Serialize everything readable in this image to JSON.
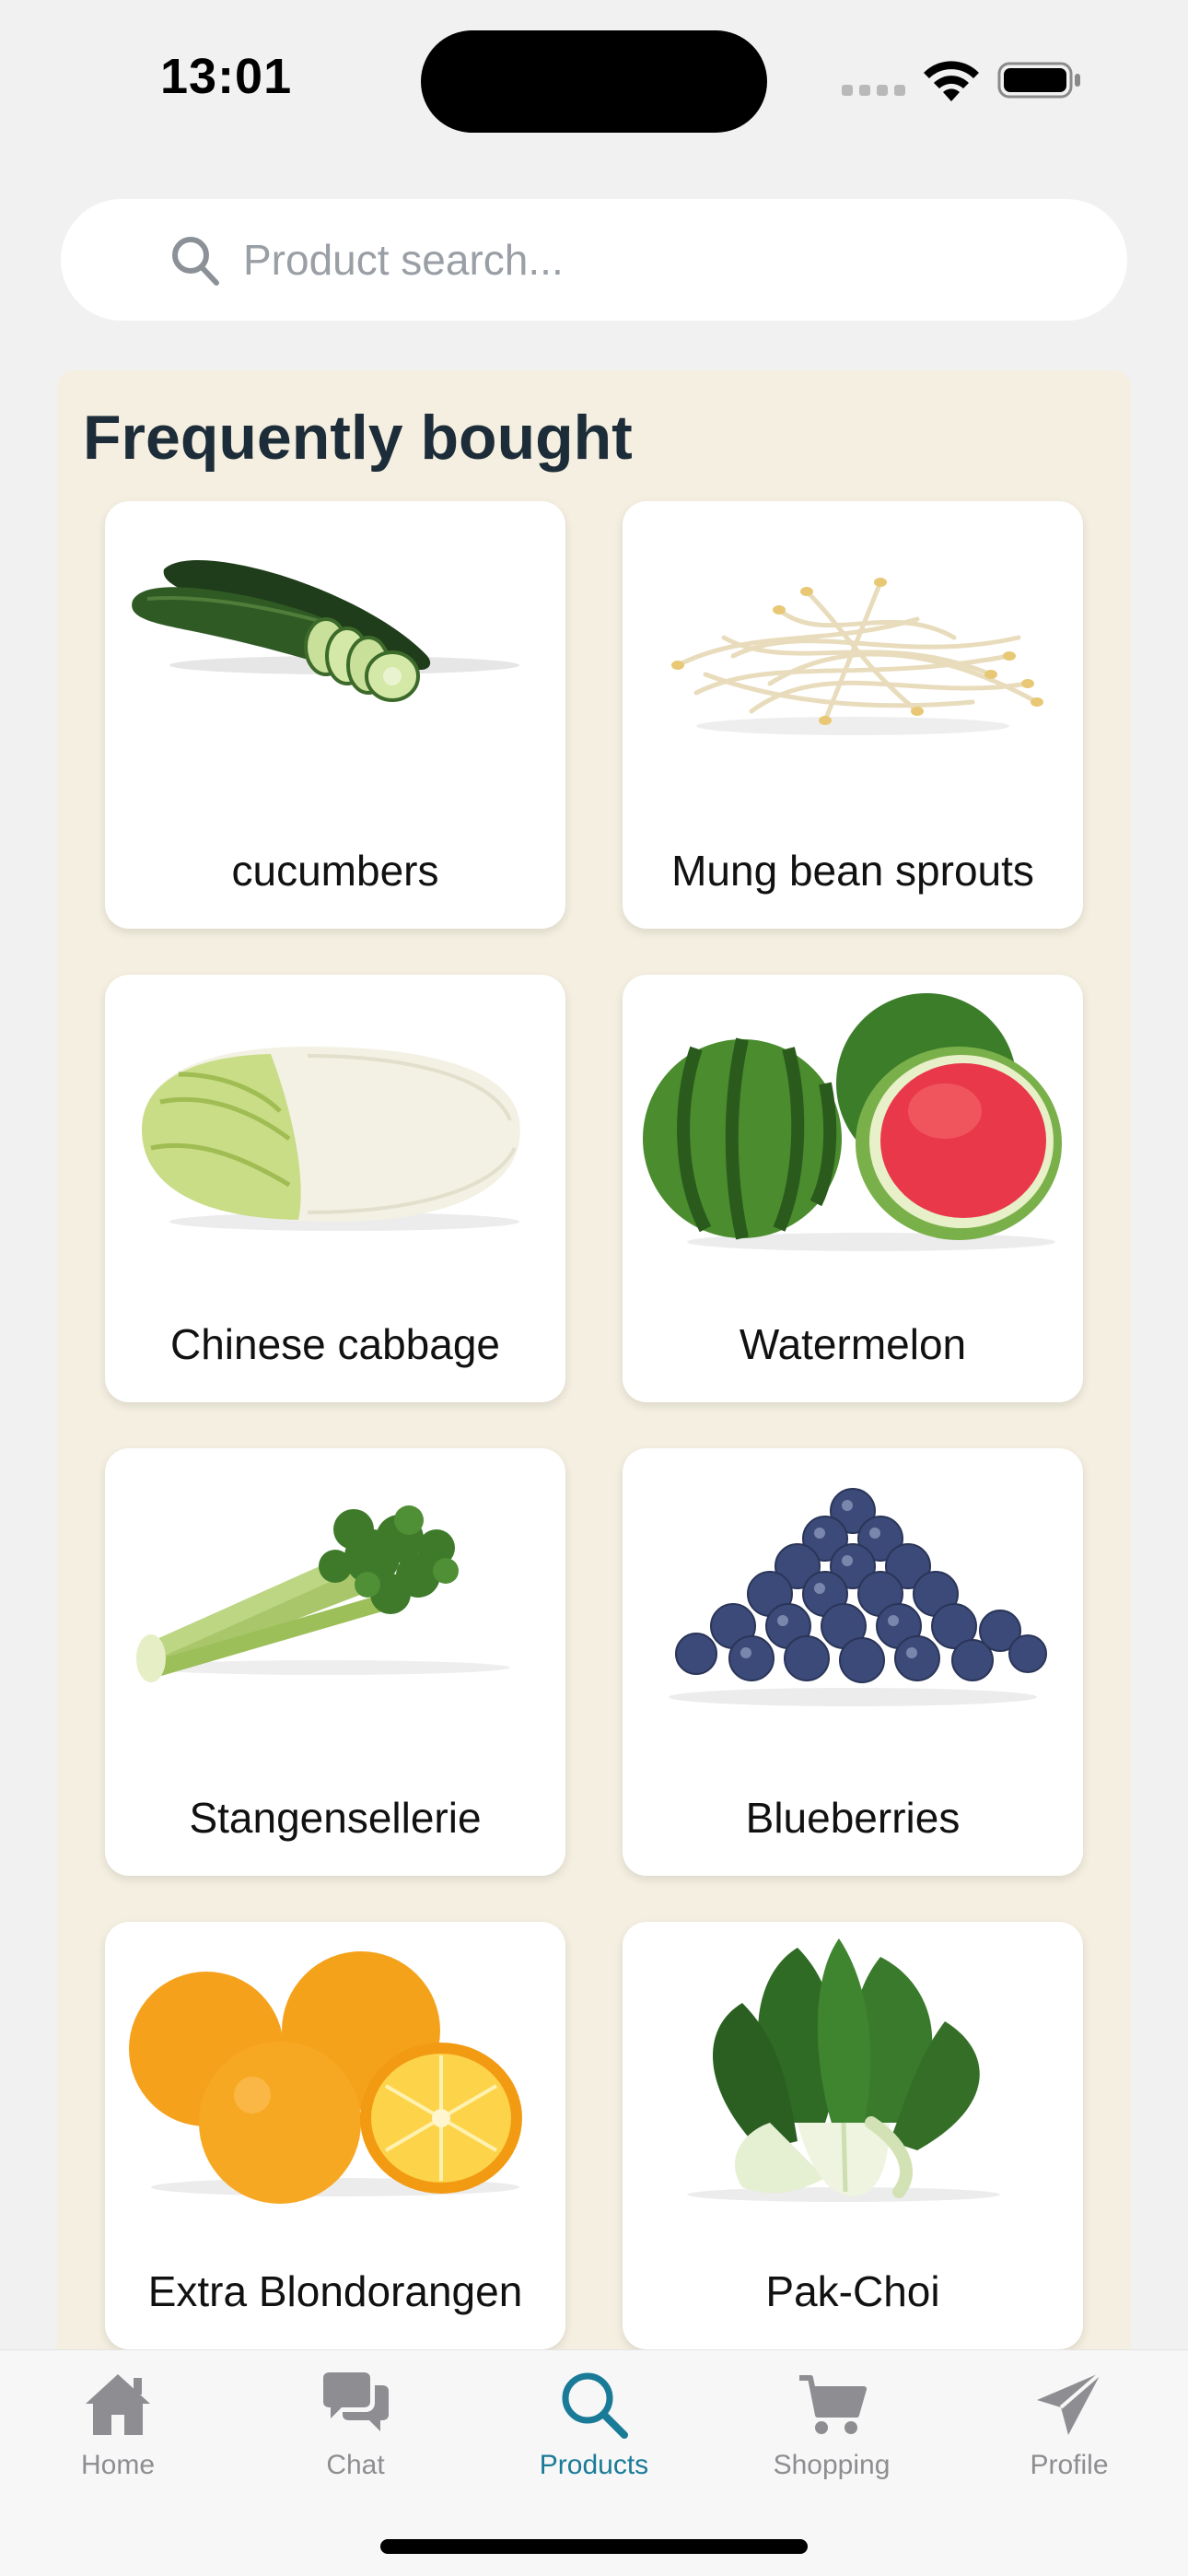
{
  "status_bar": {
    "time": "13:01"
  },
  "search": {
    "placeholder": "Product search..."
  },
  "section": {
    "title": "Frequently bought",
    "products": [
      {
        "name": "cucumbers",
        "icon": "cucumber-image"
      },
      {
        "name": "Mung bean sprouts",
        "icon": "bean-sprouts-image"
      },
      {
        "name": "Chinese cabbage",
        "icon": "cabbage-image"
      },
      {
        "name": "Watermelon",
        "icon": "watermelon-image"
      },
      {
        "name": "Stangensellerie",
        "icon": "celery-image"
      },
      {
        "name": "Blueberries",
        "icon": "blueberries-image"
      },
      {
        "name": "Extra Blondorangen",
        "icon": "oranges-image"
      },
      {
        "name": "Pak-Choi",
        "icon": "pak-choi-image"
      }
    ]
  },
  "tab_bar": {
    "active_color": "#1a7b98",
    "inactive_color": "#8e8e92",
    "tabs": [
      {
        "label": "Home",
        "icon": "home-icon",
        "active": false
      },
      {
        "label": "Chat",
        "icon": "chat-icon",
        "active": false
      },
      {
        "label": "Products",
        "icon": "search-icon",
        "active": true
      },
      {
        "label": "Shopping",
        "icon": "cart-icon",
        "active": false
      },
      {
        "label": "Profile",
        "icon": "paper-plane-icon",
        "active": false
      }
    ]
  }
}
